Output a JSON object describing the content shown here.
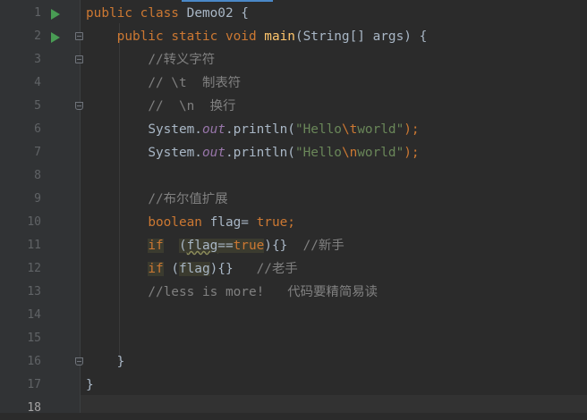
{
  "editor": {
    "lines": [
      {
        "num": "1",
        "code": "public class Demo02 {"
      },
      {
        "num": "2",
        "code": "    public static void main(String[] args) {"
      },
      {
        "num": "3",
        "code": "        //转义字符"
      },
      {
        "num": "4",
        "code": "        // \\t  制表符"
      },
      {
        "num": "5",
        "code": "        //  \\n  换行"
      },
      {
        "num": "6",
        "code": "        System.out.println(\"Hello\\tworld\");"
      },
      {
        "num": "7",
        "code": "        System.out.println(\"Hello\\nworld\");"
      },
      {
        "num": "8",
        "code": ""
      },
      {
        "num": "9",
        "code": "        //布尔值扩展"
      },
      {
        "num": "10",
        "code": "        boolean flag= true;"
      },
      {
        "num": "11",
        "code": "        if  (flag==true){}  //新手"
      },
      {
        "num": "12",
        "code": "        if (flag){}   //老手"
      },
      {
        "num": "13",
        "code": "        //less is more!   代码要精简易读"
      },
      {
        "num": "14",
        "code": ""
      },
      {
        "num": "15",
        "code": ""
      },
      {
        "num": "16",
        "code": "    }"
      },
      {
        "num": "17",
        "code": "}"
      },
      {
        "num": "18",
        "code": ""
      }
    ],
    "tokens": {
      "public": "public",
      "class": "class",
      "class_name": "Demo02",
      "brace_open": " {",
      "static": "static",
      "void": "void",
      "main": "main",
      "params": "(String[] args) {",
      "system": "System.",
      "out": "out",
      "println": ".println(",
      "hello": "\"Hello",
      "esc_t": "\\t",
      "esc_n": "\\n",
      "world": "world\"",
      "close": ");",
      "c3": "//转义字符",
      "c4": "// \\t  制表符",
      "c5": "//  \\n  换行",
      "c9": "//布尔值扩展",
      "boolean": "boolean",
      "flag_decl": " flag= ",
      "true": "true",
      "semi": ";",
      "if": "if",
      "open_paren": "(",
      "flag": "flag",
      "eqeq": "==",
      "close_body": "){}",
      "c11": "//新手",
      "c12": "//老手",
      "c13": "//less is more!   代码要精简易读",
      "brace_close": "}"
    }
  }
}
